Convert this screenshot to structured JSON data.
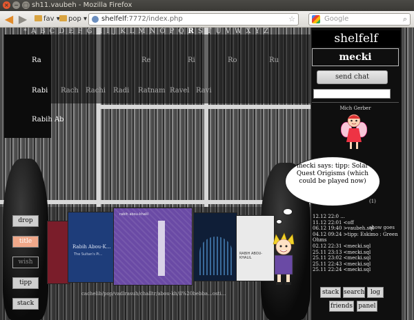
{
  "window": {
    "title": "sh11.vaubeh - Mozilla Firefox",
    "close_glyph": "×",
    "min_glyph": "−",
    "max_glyph": "□"
  },
  "toolbar": {
    "bookmarks": [
      {
        "label": "fav",
        "arrow": "▾"
      },
      {
        "label": "pop",
        "arrow": "▾"
      }
    ],
    "url_host": "shelfelf",
    "url_rest": ":7772/index.php",
    "star_glyph": "☆",
    "search_placeholder": "Google",
    "search_glyph": "⌕",
    "back_glyph": "◀",
    "forward_glyph": "▶"
  },
  "alphabet": [
    "*",
    "A",
    "B",
    "C",
    "D",
    "E",
    "F",
    "G",
    "H",
    "I",
    "J",
    "K",
    "L",
    "M",
    "N",
    "O",
    "P",
    "Q",
    "R",
    "S",
    "T",
    "U",
    "V",
    "W",
    "X",
    "Y",
    "Z"
  ],
  "alphabet_highlight": "R",
  "artists": [
    {
      "label": "Ra",
      "dim": false
    },
    {
      "label": "Re",
      "dim": true
    },
    {
      "label": "Ri",
      "dim": true
    },
    {
      "label": "Ro",
      "dim": true
    },
    {
      "label": "Ru",
      "dim": true
    },
    {
      "label": "Rabi",
      "dim": false
    },
    {
      "label": "Rach",
      "dim": true
    },
    {
      "label": "Rachi",
      "dim": true
    },
    {
      "label": "Radi",
      "dim": true
    },
    {
      "label": "Ratnam",
      "dim": true
    },
    {
      "label": "Ravel",
      "dim": true
    },
    {
      "label": "Ravi",
      "dim": true
    },
    {
      "label": "Rabih Ab",
      "dim": false
    }
  ],
  "left_buttons": {
    "drop": "drop",
    "title": "title",
    "wish": "wish",
    "tipp": "tipp",
    "stack": "stack"
  },
  "covers": {
    "cover2_title": "Rabih Abou-K...",
    "cover2_sub": "The Sultan's Pi...",
    "cover3_title": "rabih abou-khalil",
    "cover5_title": "RABIH ABOU-KHALIL"
  },
  "path_text": "cachelib/pop/vadlrasuh/challtr/abou-kh/il%20bebba...osti...",
  "panel": {
    "brand": "shelfelf",
    "user": "mecki",
    "send_chat": "send chat",
    "chat_value": "",
    "friend_name": "Mich Gerber",
    "bubble_text": "mecki says: tipp: Solar Quest Origisms (which could be played now)",
    "strip_a": "(1)",
    "strip_b": "show goes",
    "chat_log": [
      "12.12 22:0 ...",
      "11.12 22:01 <off",
      "06.12 19:40 >vaubeh.sql",
      "04.12 09:24 >tipp: Eskimo : Green",
      "Ohms",
      "02.12 22:31 <mecki.sql",
      "25.11 23:13 <mecki.sql",
      "25.11 23:02 <mecki.sql",
      "25.11 22:43 <mecki.sql",
      "25.11 22:24 <mecki.sql"
    ],
    "buttons": {
      "stack": "stack",
      "search": "search",
      "log": "log",
      "friends": "friends",
      "panel": "panel"
    }
  },
  "colors": {
    "panel_bg": "#0f0f0f",
    "title_button_bg": "#f0a88a",
    "cover_purple": "#6a4aa5",
    "cover_blue": "#1e3d7a"
  }
}
